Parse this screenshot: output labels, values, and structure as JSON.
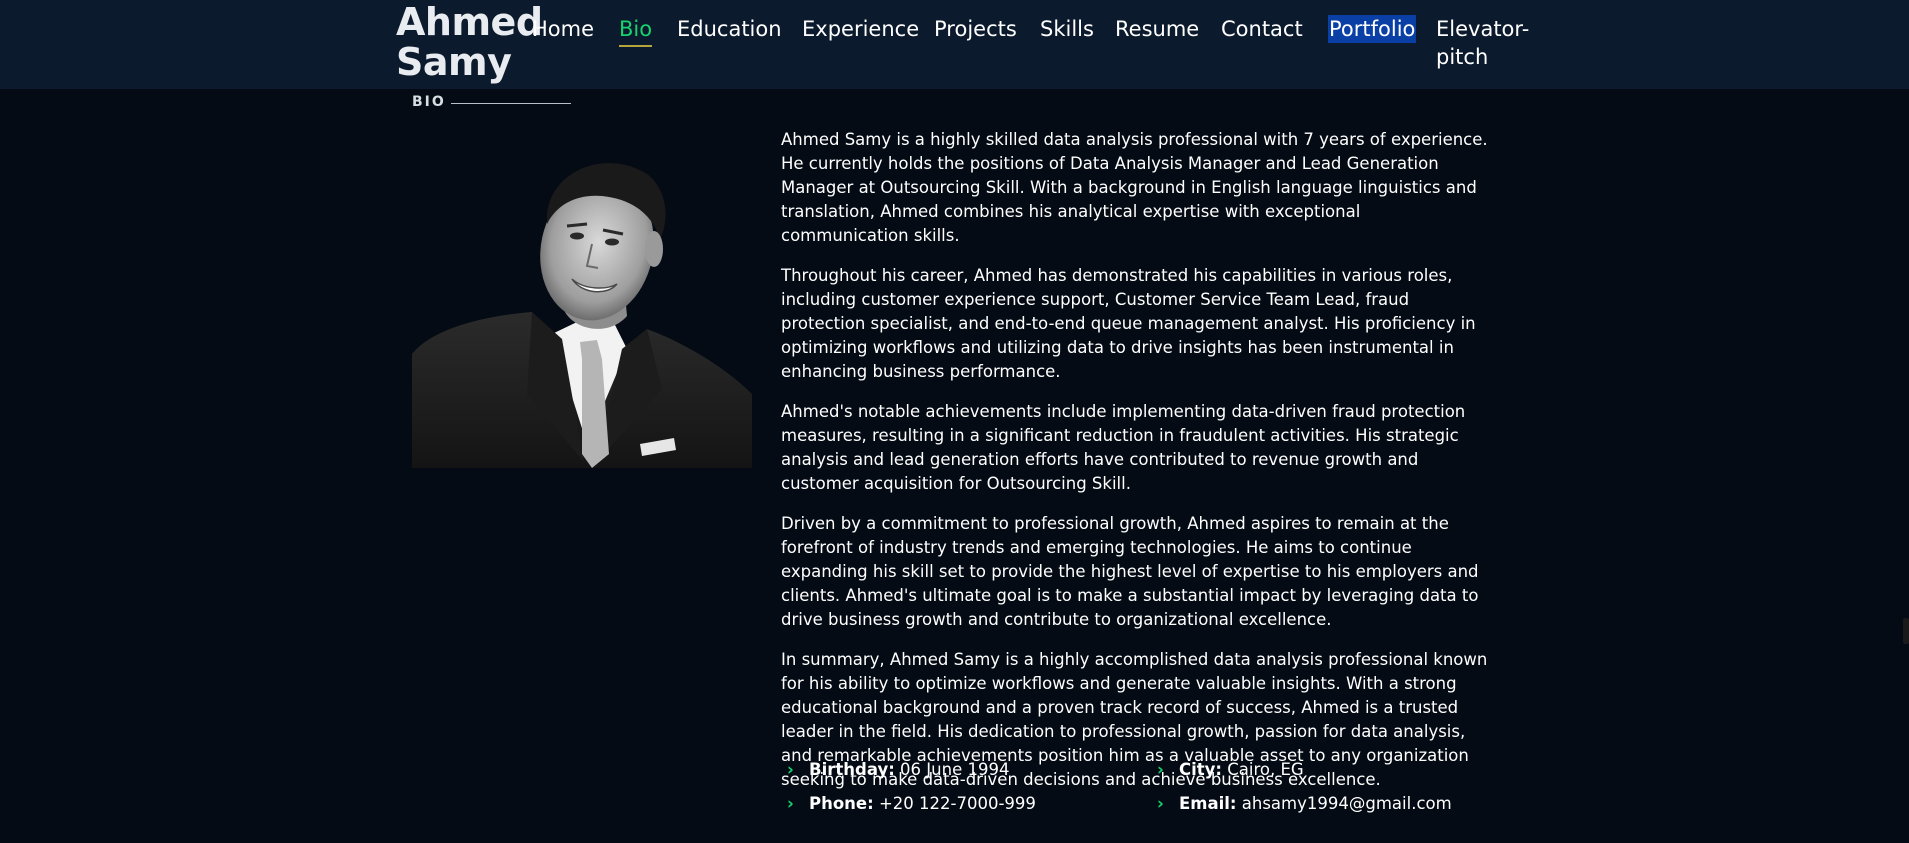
{
  "brand": {
    "line1": "Ahmed",
    "line2": "Samy"
  },
  "nav": {
    "home": "Home",
    "bio": "Bio",
    "education": "Education",
    "experience": "Experience",
    "projects": "Projects",
    "skills": "Skills",
    "resume": "Resume",
    "contact": "Contact",
    "portfolio": "Portfolio",
    "elevator": "Elevator-pitch"
  },
  "section": {
    "title": "BIO"
  },
  "bio": {
    "p1": "Ahmed Samy is a highly skilled data analysis professional with 7 years of experience. He currently holds the positions of Data Analysis Manager and Lead Generation Manager at Outsourcing Skill. With a background in English language linguistics and translation, Ahmed combines his analytical expertise with exceptional communication skills.",
    "p2": "Throughout his career, Ahmed has demonstrated his capabilities in various roles, including customer experience support, Customer Service Team Lead, fraud protection specialist, and end-to-end queue management analyst. His proficiency in optimizing workflows and utilizing data to drive insights has been instrumental in enhancing business performance.",
    "p3": "Ahmed's notable achievements include implementing data-driven fraud protection measures, resulting in a significant reduction in fraudulent activities. His strategic analysis and lead generation efforts have contributed to revenue growth and customer acquisition for Outsourcing Skill.",
    "p4": "Driven by a commitment to professional growth, Ahmed aspires to remain at the forefront of industry trends and emerging technologies. He aims to continue expanding his skill set to provide the highest level of expertise to his employers and clients. Ahmed's ultimate goal is to make a substantial impact by leveraging data to drive business growth and contribute to organizational excellence.",
    "p5": "In summary, Ahmed Samy is a highly accomplished data analysis professional known for his ability to optimize workflows and generate valuable insights. With a strong educational background and a proven track record of success, Ahmed is a trusted leader in the field. His dedication to professional growth, passion for data analysis, and remarkable achievements position him as a valuable asset to any organization seeking to make data-driven decisions and achieve business excellence."
  },
  "facts": {
    "birthday": {
      "label": "Birthday:",
      "value": "06 June 1994"
    },
    "city": {
      "label": "City:",
      "value": "Cairo, EG"
    },
    "phone": {
      "label": "Phone:",
      "value": "+20 122-7000-999"
    },
    "email": {
      "label": "Email:",
      "value": "ahsamy1994@gmail.com"
    }
  },
  "icons": {
    "fact_bullet": "chevron-right-icon"
  },
  "colors": {
    "accent": "#18d26e",
    "header_bg": "#0b1a2c",
    "page_bg": "#040b14",
    "selection": "#0a3fa6"
  }
}
